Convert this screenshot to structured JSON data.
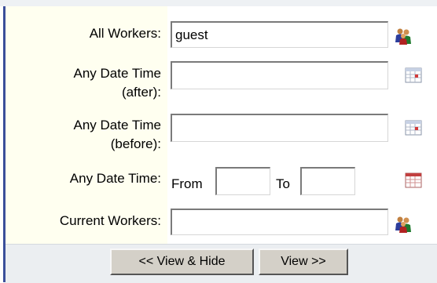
{
  "filters": {
    "all_workers": {
      "label": "All Workers:",
      "value": "guest",
      "icon": "people-icon"
    },
    "date_after": {
      "label_line1": "Any Date Time",
      "label_line2": "(after):",
      "value": "",
      "icon": "calendar-icon"
    },
    "date_before": {
      "label_line1": "Any Date Time",
      "label_line2": "(before):",
      "value": "",
      "icon": "calendar-icon"
    },
    "date_range": {
      "label": "Any Date Time:",
      "from_label": "From",
      "to_label": "To",
      "from_value": "",
      "to_value": "",
      "icon": "calendar-icon"
    },
    "current_workers": {
      "label": "Current Workers:",
      "value": "",
      "icon": "people-icon"
    }
  },
  "buttons": {
    "view_hide": "<< View & Hide",
    "view": "View >>"
  },
  "colors": {
    "label_background": "#fffff0",
    "footer_background": "#ebeef1",
    "left_rule": "#3b4f9a",
    "button_face": "#d4d0c8"
  }
}
